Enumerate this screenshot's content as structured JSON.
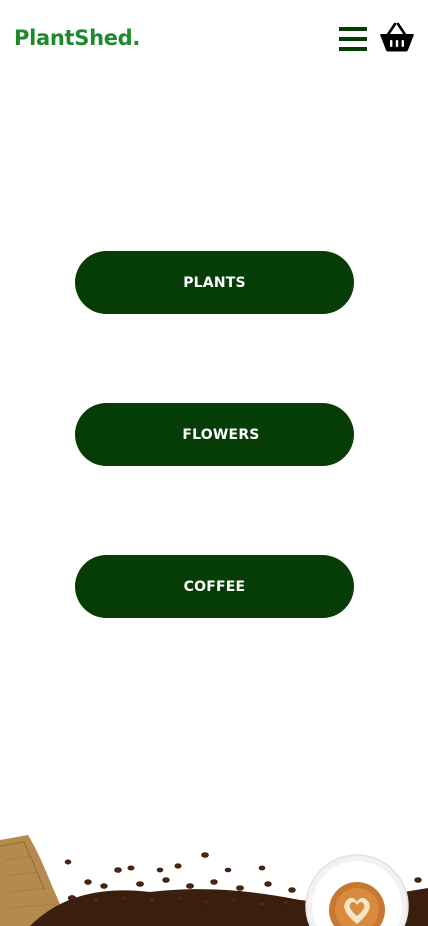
{
  "header": {
    "logo": "PlantShed.",
    "menu_icon": "hamburger-menu-icon",
    "basket_icon": "shopping-basket-icon"
  },
  "categories": [
    {
      "label": "PLANTS"
    },
    {
      "label": "FLOWERS"
    },
    {
      "label": "COFFEE"
    }
  ],
  "colors": {
    "brand_green": "#1e8a2c",
    "button_green": "#063d07",
    "button_text": "#ffffff",
    "background": "#ffffff"
  }
}
